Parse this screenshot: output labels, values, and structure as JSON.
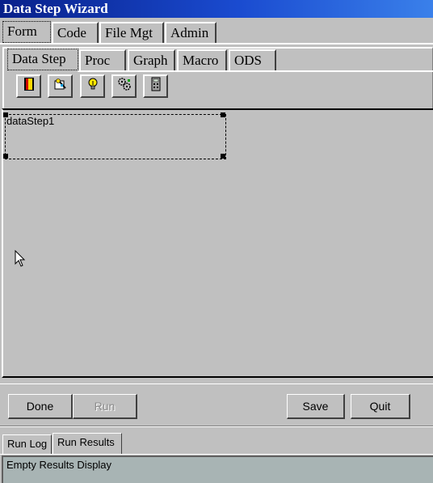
{
  "window": {
    "title": "Data Step Wizard"
  },
  "main_tabs": [
    {
      "label": "Form",
      "selected": true
    },
    {
      "label": "Code"
    },
    {
      "label": "File Mgt"
    },
    {
      "label": "Admin"
    }
  ],
  "sub_tabs": [
    {
      "label": "Data Step",
      "selected": true
    },
    {
      "label": "Proc"
    },
    {
      "label": "Graph"
    },
    {
      "label": "Macro"
    },
    {
      "label": "ODS"
    }
  ],
  "toolbar": [
    {
      "icon": "door-icon"
    },
    {
      "icon": "wand-icon"
    },
    {
      "icon": "lightbulb-icon"
    },
    {
      "icon": "gears-icon"
    },
    {
      "icon": "calculator-icon"
    }
  ],
  "canvas": {
    "component_label": "dataStep1"
  },
  "buttons": {
    "done": "Done",
    "run": "Run",
    "save": "Save",
    "quit": "Quit"
  },
  "bottom_tabs": [
    {
      "label": "Run Log"
    },
    {
      "label": "Run Results",
      "selected": true
    }
  ],
  "results": {
    "text": "Empty Results Display"
  },
  "colors": {
    "title_bar": "#0a246a",
    "panel": "#c0c0c0",
    "results_bg": "#a8b4b4"
  }
}
